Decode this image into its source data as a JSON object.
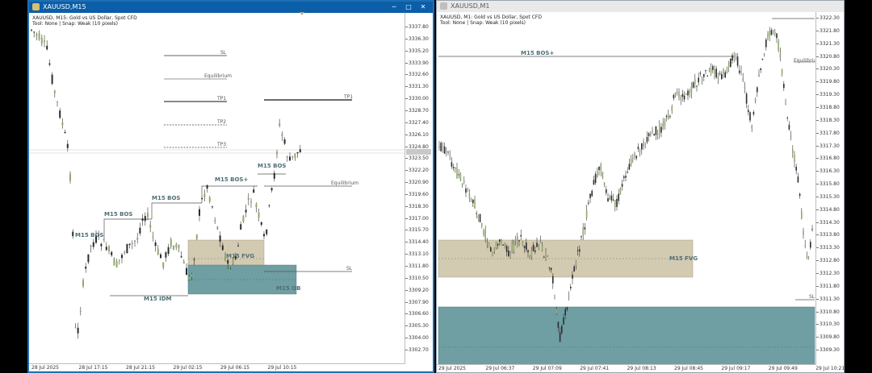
{
  "left": {
    "title": "XAUUSD,M15",
    "info_line1": "XAUUSD, M15:  Gold vs US Dollar, Spot CFD",
    "info_line2": "Tool: None | Snap: Weak (10 pixels)",
    "price_ticks": [
      "3337.80",
      "3336.30",
      "3335.20",
      "3333.90",
      "3332.60",
      "3331.30",
      "3330.00",
      "3328.70",
      "3327.40",
      "3326.10",
      "3324.80",
      "3323.50",
      "3322.20",
      "3320.90",
      "3319.60",
      "3318.30",
      "3317.00",
      "3315.70",
      "3314.40",
      "3313.10",
      "3311.80",
      "3310.50",
      "3309.20",
      "3307.90",
      "3306.60",
      "3305.30",
      "3304.00",
      "3302.70"
    ],
    "time_ticks": [
      "28 Jul 2025",
      "28 Jul 17:15",
      "28 Jul 21:15",
      "29 Jul 02:15",
      "29 Jul 06:15",
      "29 Jul 10:15"
    ],
    "labels": {
      "sl_top": "SL",
      "equilibrium_top": "Equilibrium",
      "tp1_left": "TP1",
      "tp2": "TP2",
      "tp3": "TP3",
      "tp1_right": "TP1",
      "equilibrium_right": "Equilibrium",
      "sl_right": "SL",
      "bos1": "M15 BOS",
      "bos2": "M15 BOS",
      "bos3": "M15 BOS",
      "bos4": "M15 BOS",
      "bos_plus": "M15 BOS+",
      "idm": "M15 IDM",
      "fvg": "M15 FVG",
      "ob": "M15 OB"
    }
  },
  "right": {
    "title": "XAUUSD,M1",
    "info_line1": "XAUUSD, M1:  Gold vs US Dollar, Spot CFD",
    "info_line2": "Tool: None | Snap: Weak (10 pixels)",
    "price_ticks": [
      "3322.30",
      "3321.80",
      "3321.30",
      "3320.80",
      "3320.30",
      "3319.80",
      "3319.30",
      "3318.80",
      "3318.30",
      "3317.80",
      "3317.30",
      "3316.80",
      "3316.30",
      "3315.80",
      "3315.30",
      "3314.80",
      "3314.30",
      "3313.80",
      "3313.30",
      "3312.80",
      "3312.30",
      "3311.80",
      "3311.30",
      "3310.80",
      "3310.30",
      "3309.80",
      "3309.30"
    ],
    "time_ticks": [
      "29 Jul 2025",
      "29 Jul 06:37",
      "29 Jul 07:09",
      "29 Jul 07:41",
      "29 Jul 08:13",
      "29 Jul 08:45",
      "29 Jul 09:17",
      "29 Jul 09:49",
      "29 Jul 10:21"
    ],
    "labels": {
      "bos_plus": "M15 BOS+",
      "fvg": "M15 FVG",
      "equilibrium": "Equilibrium",
      "sl": "SL"
    }
  },
  "controls": {
    "minimize": "─",
    "maximize": "□",
    "close": "✕"
  },
  "colors": {
    "bull_candle": "#8faa6a",
    "bear_candle": "#2c2c2c",
    "fvg_zone": "#d3cab2",
    "ob_zone": "#6f9ea3",
    "label_text": "#4f6f76"
  }
}
